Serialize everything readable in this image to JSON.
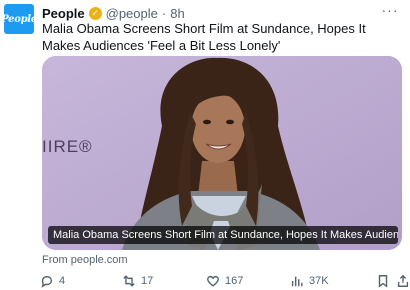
{
  "post": {
    "display_name": "People",
    "handle": "@people",
    "separator": "·",
    "time": "8h",
    "text": "Malia Obama Screens Short Film at Sundance, Hopes It Makes Audiences 'Feel a Bit Less Lonely'"
  },
  "avatar": {
    "logo_text": "People",
    "brand_color": "#1d9bf0"
  },
  "verified_badge_color": "#e8b31a",
  "card": {
    "caption": "Malia Obama Screens Short Film at Sundance, Hopes It Makes Audiences 'Feel a B...",
    "backdrop_text": "IIRE®",
    "source": "From people.com"
  },
  "actions": {
    "replies": "4",
    "reposts": "17",
    "likes": "167",
    "views": "37K"
  },
  "icons": [
    "reply-icon",
    "repost-icon",
    "like-icon",
    "views-icon",
    "bookmark-icon",
    "share-icon",
    "more-icon",
    "verified-badge-icon"
  ]
}
